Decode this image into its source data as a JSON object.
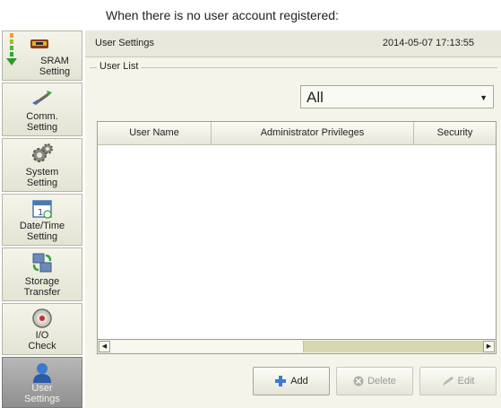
{
  "caption": "When there is no user account registered:",
  "sidebar": {
    "items": [
      {
        "label": "SRAM\nSetting",
        "icon": "sram-icon"
      },
      {
        "label": "Comm.\nSetting",
        "icon": "comm-icon"
      },
      {
        "label": "System\nSetting",
        "icon": "gear-icon"
      },
      {
        "label": "Date/Time\nSetting",
        "icon": "calendar-icon"
      },
      {
        "label": "Storage\nTransfer",
        "icon": "storage-transfer-icon"
      },
      {
        "label": "I/O\nCheck",
        "icon": "io-check-icon"
      },
      {
        "label": "User\nSettings",
        "icon": "user-icon",
        "active": true
      }
    ]
  },
  "header": {
    "title": "User Settings",
    "datetime": "2014-05-07  17:13:55"
  },
  "user_list": {
    "group_label": "User List",
    "filter": {
      "selected": "All"
    },
    "columns": [
      "User Name",
      "Administrator Privileges",
      "Security"
    ],
    "rows": []
  },
  "buttons": {
    "add": "Add",
    "delete": "Delete",
    "edit": "Edit"
  },
  "colors": {
    "panel_bg": "#f4f4ea",
    "active_nav": "#8e8e8e",
    "scroll_track": "#d8d8b0"
  }
}
